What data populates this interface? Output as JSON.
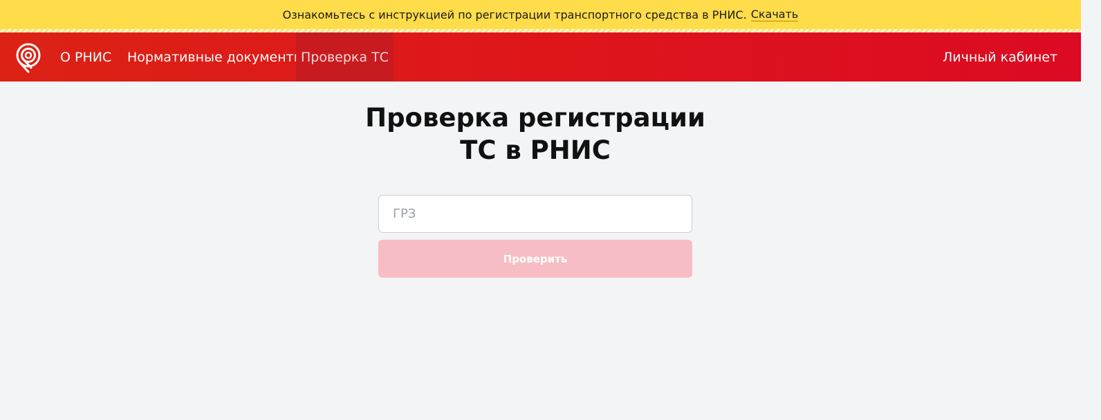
{
  "banner": {
    "text": "Ознакомьтесь с инструкцией по регистрации транспортного средства в РНИС.",
    "link_label": "Скачать"
  },
  "navbar": {
    "logo_icon": "rnis-logo-icon",
    "items": [
      {
        "label": "О РНИС"
      },
      {
        "label": "Нормативные документы"
      },
      {
        "label": "Проверка ТС",
        "active": true
      }
    ],
    "cabinet_label": "Личный кабинет"
  },
  "main": {
    "title_line1": "Проверка регистрации",
    "title_line2": "ТС в РНИС",
    "grz_placeholder": "ГРЗ",
    "grz_value": "",
    "check_button_label": "Проверить"
  },
  "colors": {
    "banner_bg": "#ffdc4a",
    "navbar_red": "#de161c",
    "active_tab_bg": "#c81b20",
    "page_bg": "#f3f4f6",
    "button_disabled_bg": "#f7bdc4"
  }
}
